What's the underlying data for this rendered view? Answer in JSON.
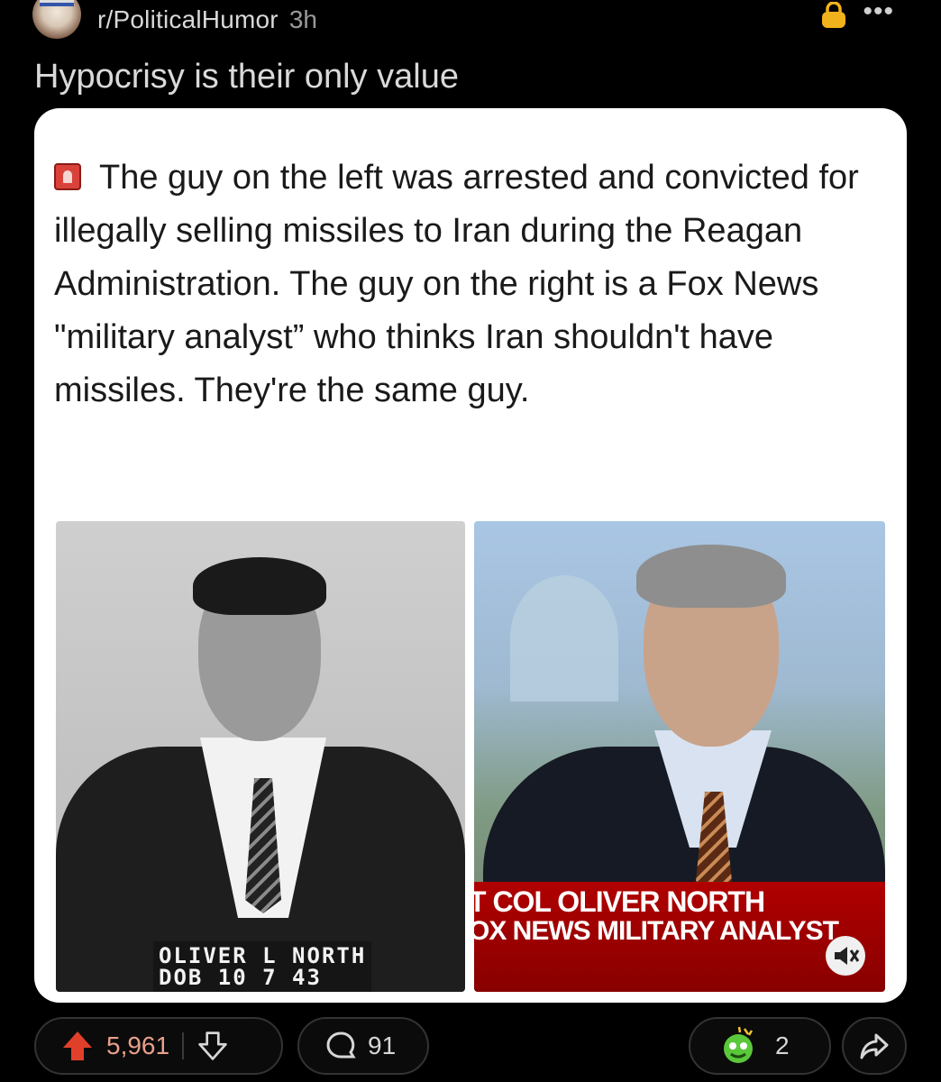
{
  "header": {
    "subreddit": "r/PoliticalHumor",
    "age": "3h",
    "more_label": "•••"
  },
  "post": {
    "title": "Hypocrisy is their only value",
    "tweet_text": "The guy on the left was arrested and convicted for illegally selling missiles to Iran during the Reagan Administration. The guy on the right is a Fox News \"military analyst” who thinks Iran shouldn't have missiles. They're the same guy.",
    "mugshot_caption_line1": "OLIVER L NORTH",
    "mugshot_caption_line2": "DOB 10 7 43",
    "chyron_line1": "T COL OLIVER NORTH",
    "chyron_line2": "OX NEWS MILITARY ANALYST"
  },
  "actions": {
    "upvotes": "5,961",
    "comments": "91",
    "awards": "2"
  },
  "colors": {
    "upvote": "#e0402a",
    "lock": "#f2b21b",
    "award": "#5ac83a",
    "chyron": "#a00000"
  },
  "icons": {
    "upvote": "upvote-arrow-icon",
    "downvote": "downvote-arrow-icon",
    "comment": "comment-bubble-icon",
    "award": "award-icon",
    "share": "share-arrow-icon",
    "lock": "lock-icon",
    "mute": "mute-speaker-icon",
    "alarm": "alarm-emoji-icon"
  }
}
